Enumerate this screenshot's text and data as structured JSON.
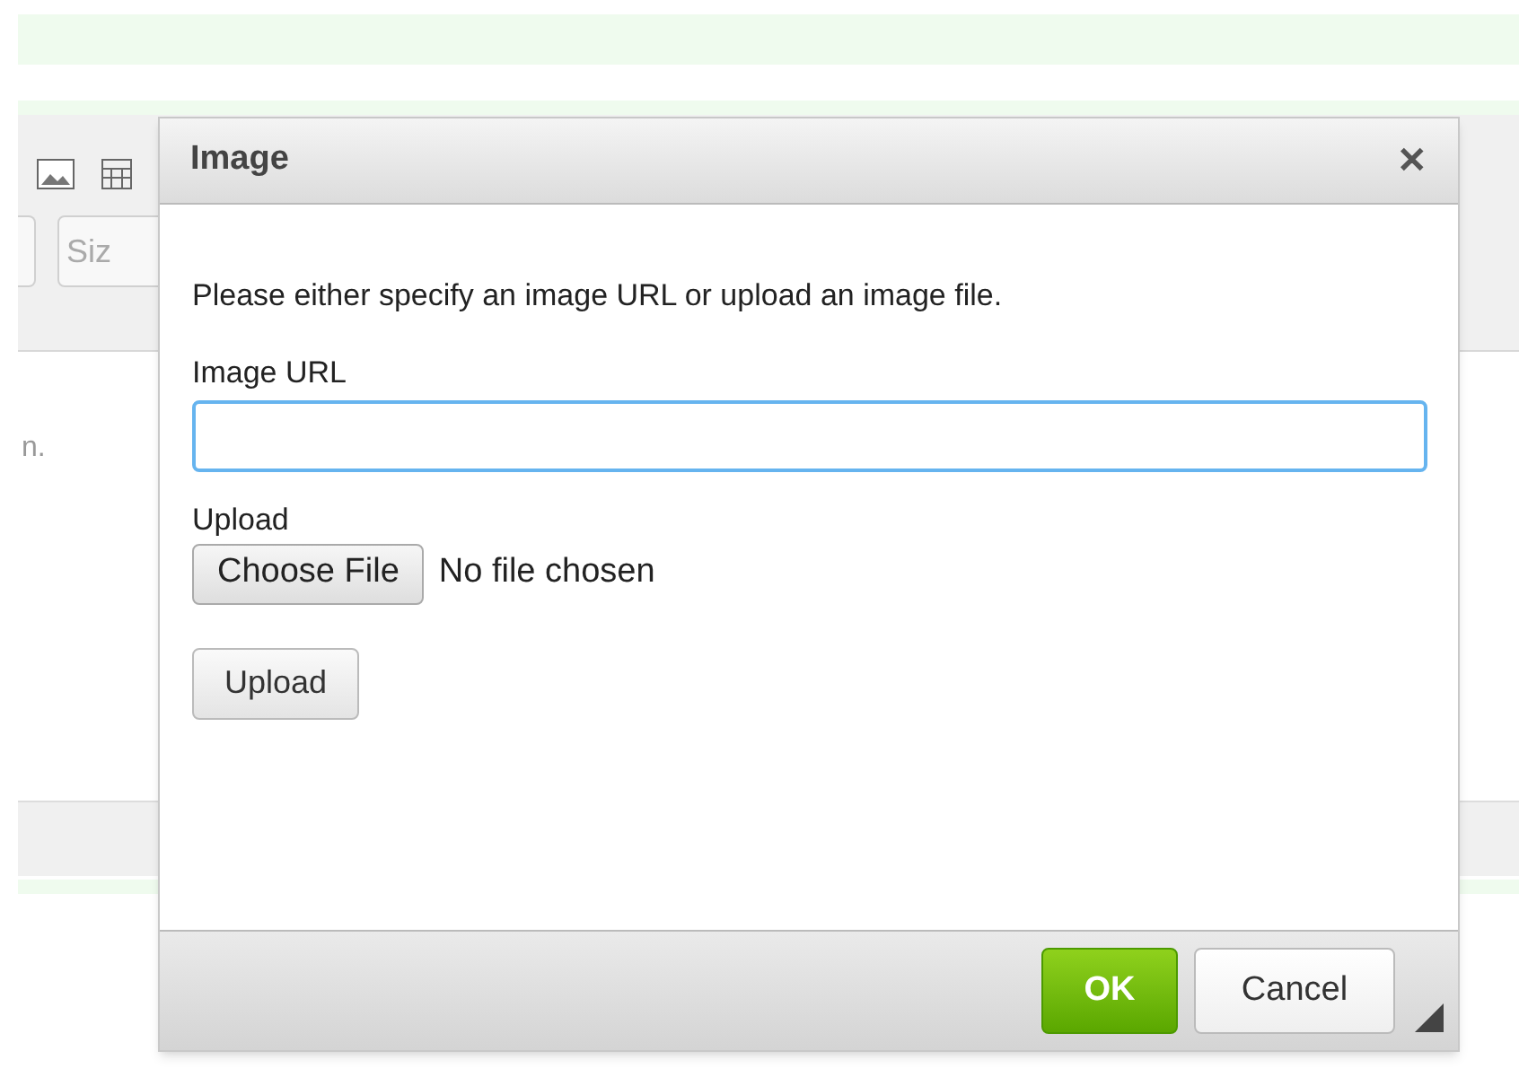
{
  "editor": {
    "size_field": {
      "placeholder": "Siz"
    },
    "content_text": "n."
  },
  "dialog": {
    "title": "Image",
    "close_label": "✕",
    "intro": "Please either specify an image URL or upload an image file.",
    "url_field": {
      "label": "Image URL",
      "focused": true
    },
    "upload": {
      "label": "Upload",
      "choose_button": "Choose File",
      "file_status": "No file chosen",
      "upload_button": "Upload"
    },
    "buttons": [
      {
        "label": "OK",
        "kind": "primary"
      },
      {
        "label": "Cancel",
        "kind": "secondary"
      }
    ]
  }
}
